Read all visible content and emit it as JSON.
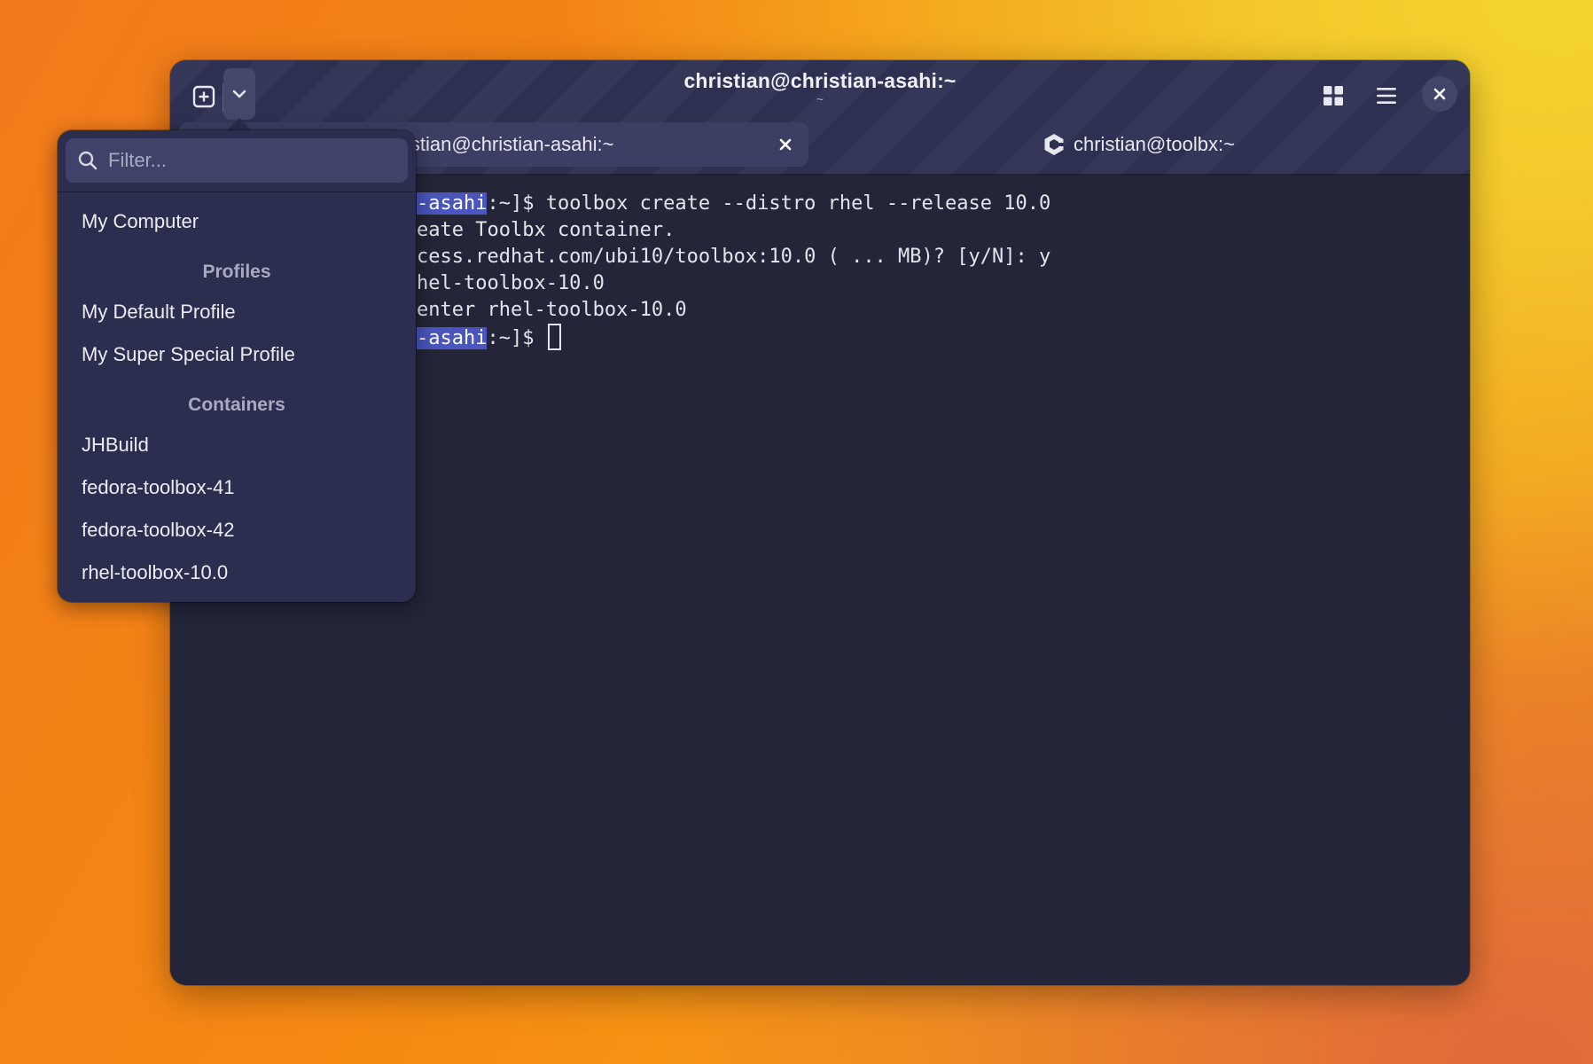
{
  "window": {
    "title": "christian@christian-asahi:~",
    "subtitle": "~"
  },
  "tabs": [
    {
      "label": "christian@christian-asahi:~",
      "visible_label": "istian@christian-asahi:~",
      "active": true
    },
    {
      "label": "christian@toolbx:~",
      "active": false,
      "icon": "toolbox-icon"
    }
  ],
  "terminal": {
    "lines": [
      {
        "highlight": "-asahi",
        "text": ":~]$ toolbox create --distro rhel --release 10.0"
      },
      {
        "highlight": "",
        "text": "eate Toolbx container."
      },
      {
        "highlight": "",
        "text": "cess.redhat.com/ubi10/toolbox:10.0 ( ... MB)? [y/N]: y"
      },
      {
        "highlight": "",
        "text": "hel-toolbox-10.0"
      },
      {
        "highlight": "",
        "text": "enter rhel-toolbox-10.0"
      },
      {
        "highlight": "-asahi",
        "text": ":~]$ "
      }
    ]
  },
  "popover": {
    "search_placeholder": "Filter...",
    "my_computer": "My Computer",
    "profiles_heading": "Profiles",
    "profiles": [
      "My Default Profile",
      "My Super Special Profile"
    ],
    "containers_heading": "Containers",
    "containers": [
      "JHBuild",
      "fedora-toolbox-41",
      "fedora-toolbox-42",
      "rhel-toolbox-10.0"
    ]
  },
  "colors": {
    "window_bg": "#242539",
    "header_bg": "#2e3052",
    "selection": "#4a55bd",
    "popover_bg": "#2c2e4f"
  }
}
